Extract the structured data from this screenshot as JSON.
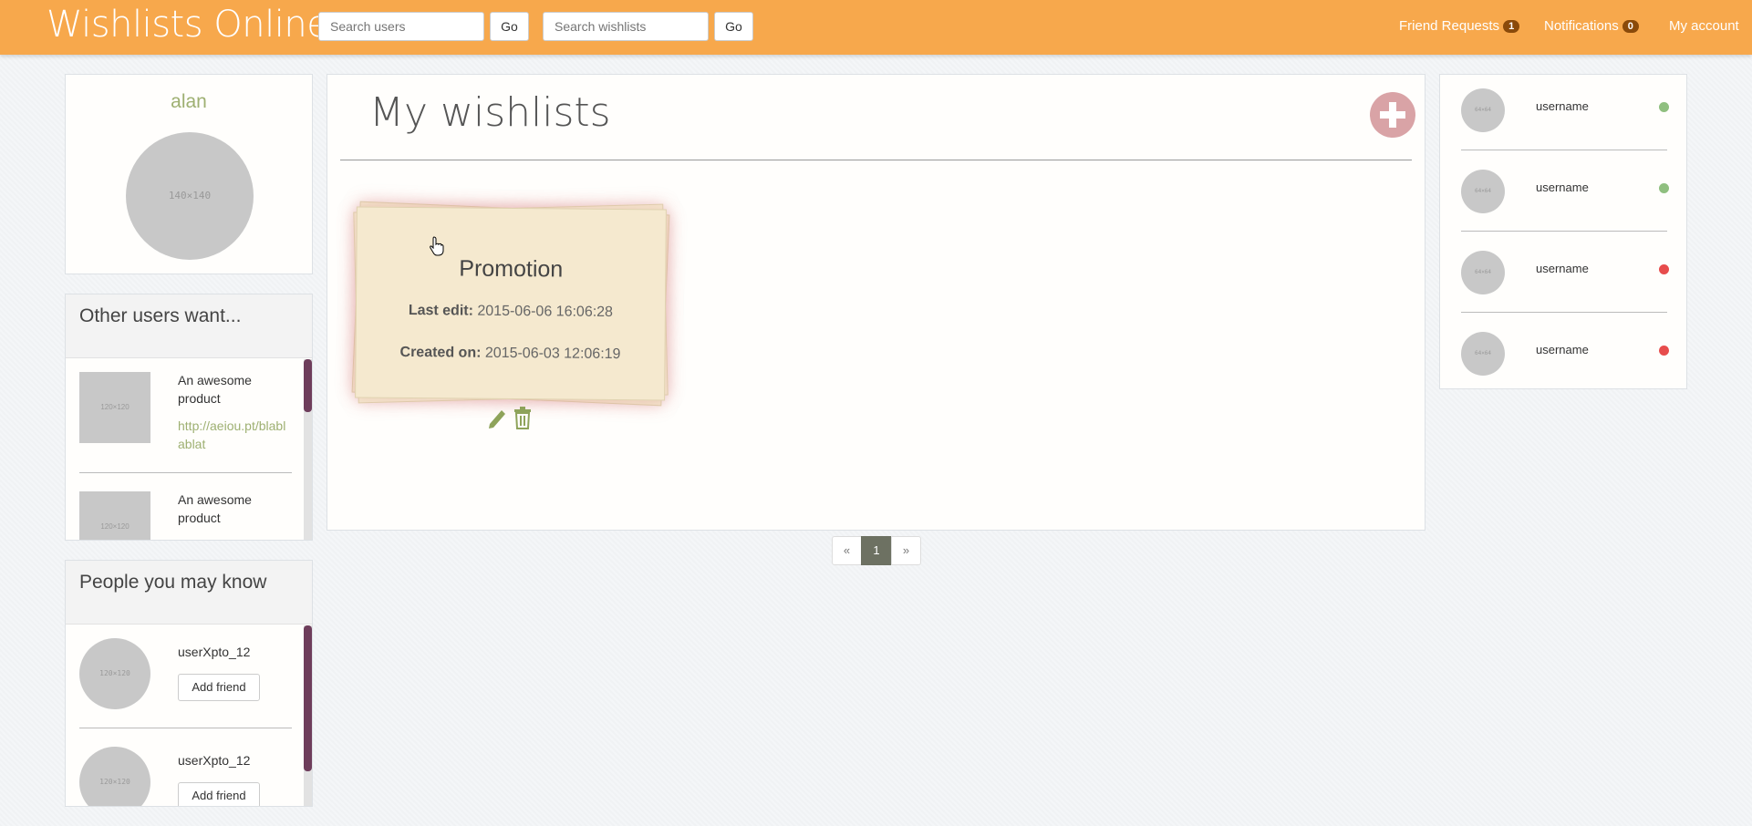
{
  "navbar": {
    "brand": "Wishlists Online",
    "search_users_placeholder": "Search users",
    "search_wishlists_placeholder": "Search wishlists",
    "go_label": "Go",
    "friend_requests_label": "Friend Requests",
    "friend_requests_count": "1",
    "notifications_label": "Notifications",
    "notifications_count": "0",
    "my_account_label": "My account"
  },
  "profile": {
    "username": "alan",
    "avatar_text": "140×140"
  },
  "other_users_want": {
    "title": "Other users want...",
    "items": [
      {
        "name": "An awesome product",
        "link": "http://aeiou.pt/blablablat",
        "thumb": "120×120"
      },
      {
        "name": "An awesome product",
        "thumb": "120×120"
      }
    ]
  },
  "people_you_may_know": {
    "title": "People you may know",
    "add_friend_label": "Add friend",
    "people": [
      {
        "username": "userXpto_12",
        "avatar": "120×120"
      },
      {
        "username": "userXpto_12",
        "avatar": "120×120"
      }
    ]
  },
  "main": {
    "title": "My wishlists",
    "wishlist": {
      "name": "Promotion",
      "last_edit_label": "Last edit:",
      "last_edit_value": "2015-06-06 16:06:28",
      "created_label": "Created on:",
      "created_value": "2015-06-03 12:06:19"
    },
    "pagination": {
      "prev": "«",
      "page": "1",
      "next": "»"
    }
  },
  "friends": {
    "list": [
      {
        "name": "username",
        "status": "online",
        "avatar": "64×64"
      },
      {
        "name": "username",
        "status": "online",
        "avatar": "64×64"
      },
      {
        "name": "username",
        "status": "offline",
        "avatar": "64×64"
      },
      {
        "name": "username",
        "status": "offline",
        "avatar": "64×64"
      }
    ]
  },
  "colors": {
    "navbar": "#f7a84c",
    "accent_green": "#9eb072",
    "online": "#8fbf7f",
    "offline": "#e74c4c",
    "add_button": "#d9a3a6",
    "scroll_thumb": "#6e3d5b"
  }
}
